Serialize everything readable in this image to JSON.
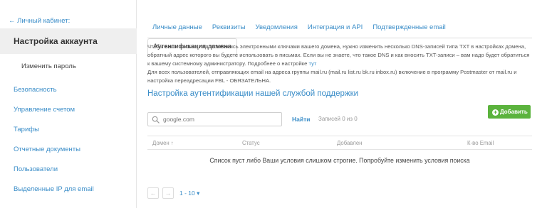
{
  "sidebar": {
    "back_link": "← Личный кабинет:",
    "header": "Настройка аккаунта",
    "sub_item": "Изменить пароль",
    "items": [
      {
        "label": "Безопасность"
      },
      {
        "label": "Управление счетом"
      },
      {
        "label": "Тарифы"
      },
      {
        "label": "Отчетные документы"
      },
      {
        "label": "Пользователи"
      },
      {
        "label": "Выделенные IP для email"
      }
    ]
  },
  "tabs": [
    {
      "label": "Личные данные"
    },
    {
      "label": "Реквизиты"
    },
    {
      "label": "Уведомления"
    },
    {
      "label": "Интеграция и API"
    },
    {
      "label": "Подтвержденные email"
    },
    {
      "label": "Аутентификация домена",
      "active": true
    }
  ],
  "info": {
    "paragraph1": "Чтобы ваши письма подписывались электронными ключами вашего домена, нужно изменить несколько DNS-записей типа TXT в настройках домена, обратный адрес которого вы будете использовать в письмах. Если вы не знаете, что такое DNS и как вносить TXT-записи – вам надо будет обратиться к вашему системному администратору. Подробнее о настройке",
    "link": "тут",
    "paragraph2": " Для всех пользователей, отправляющих email на адреса группы mail.ru (mail.ru list.ru bk.ru inbox.ru) включение в программу Postmaster от mail.ru и настройка переадресации FBL - ОБЯЗАТЕЛЬНА."
  },
  "section_title": "Настройка аутентификации нашей службой поддержки",
  "search": {
    "placeholder": "google.com",
    "find_label": "Найти",
    "records": "Записей 0 из 0"
  },
  "add_button": "Добавить",
  "table": {
    "columns": [
      "Домен ↑",
      "Статус",
      "Добавлен",
      "К-во Email"
    ],
    "empty_message": "Список пуст либо Ваши условия слишком строгие. Попробуйте изменить условия поиска"
  },
  "pager": {
    "prev": "←",
    "next": "→",
    "range": "1 - 10 ▾"
  },
  "colors": {
    "link": "#3a8dc8",
    "button_green": "#5bb33d",
    "header_bg": "#efefef"
  }
}
